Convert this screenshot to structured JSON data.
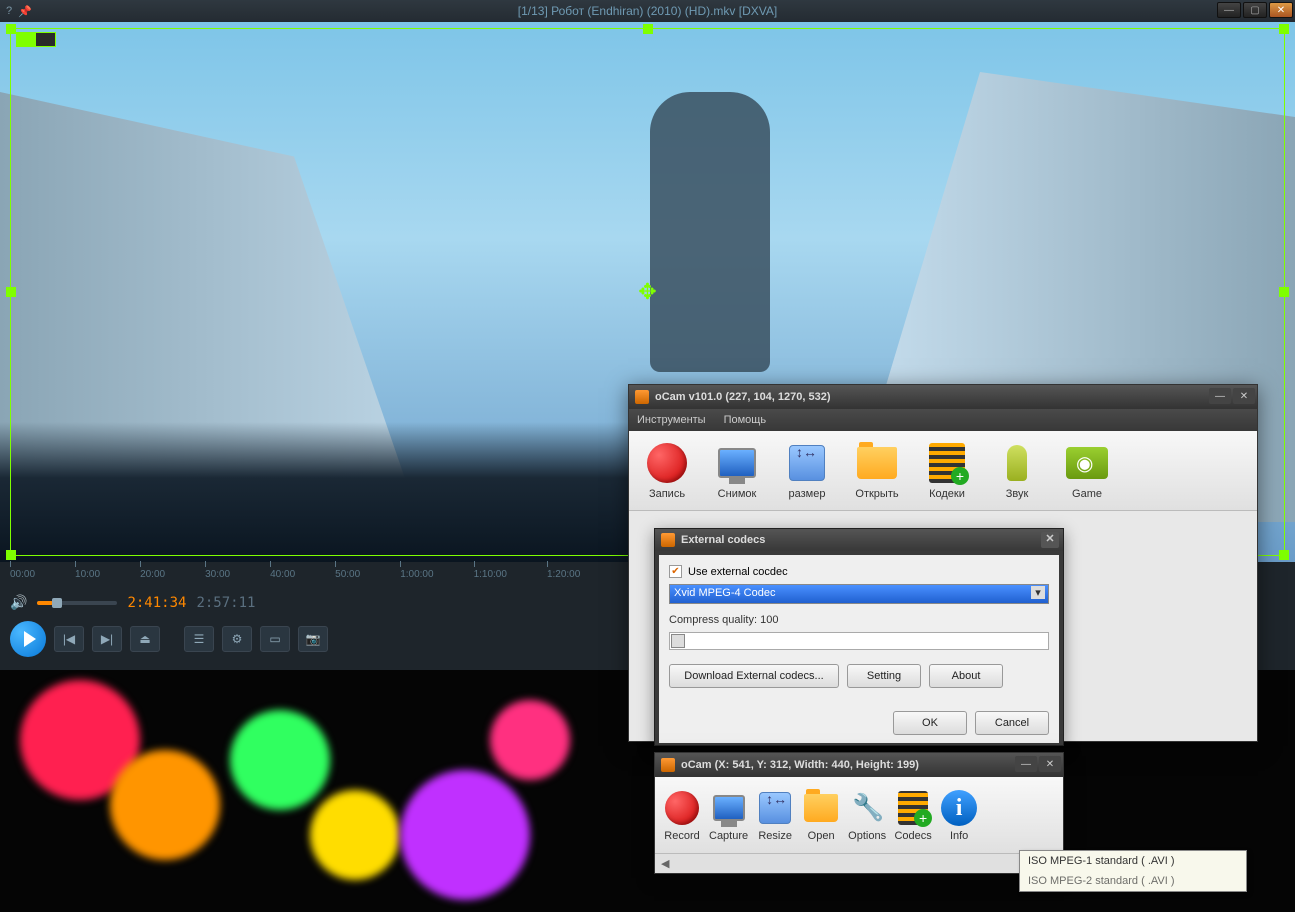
{
  "player": {
    "title": "[1/13] Робот (Endhiran) (2010) (HD).mkv [DXVA]",
    "timeline": [
      "00:00",
      "10:00",
      "20:00",
      "30:00",
      "40:00",
      "50:00",
      "1:00:00",
      "1:10:00",
      "1:20:00"
    ],
    "current_time": "2:41:34",
    "total_time": "2:57:11"
  },
  "ocam_main": {
    "title": "oCam v101.0 (227, 104, 1270, 532)",
    "menu": {
      "tools": "Инструменты",
      "help": "Помощь"
    },
    "toolbar": {
      "record": "Запись",
      "capture": "Снимок",
      "resize": "размер",
      "open": "Открыть",
      "codecs": "Кодеки",
      "sound": "Звук",
      "game": "Game"
    }
  },
  "codec_dialog": {
    "title": "External codecs",
    "use_external": "Use external cocdec",
    "selected_codec": "Xvid MPEG-4 Codec",
    "quality_label": "Compress quality: 100",
    "download": "Download External codecs...",
    "setting": "Setting",
    "about": "About",
    "ok": "OK",
    "cancel": "Cancel"
  },
  "ocam2": {
    "title": "oCam (X: 541, Y: 312, Width: 440, Height: 199)",
    "toolbar": {
      "record": "Record",
      "capture": "Capture",
      "resize": "Resize",
      "open": "Open",
      "options": "Options",
      "codecs": "Codecs",
      "info": "Info"
    }
  },
  "codec_tip": {
    "row1": "ISO MPEG-1 standard ( .AVI )",
    "row2": "ISO MPEG-2 standard ( .AVI )"
  }
}
